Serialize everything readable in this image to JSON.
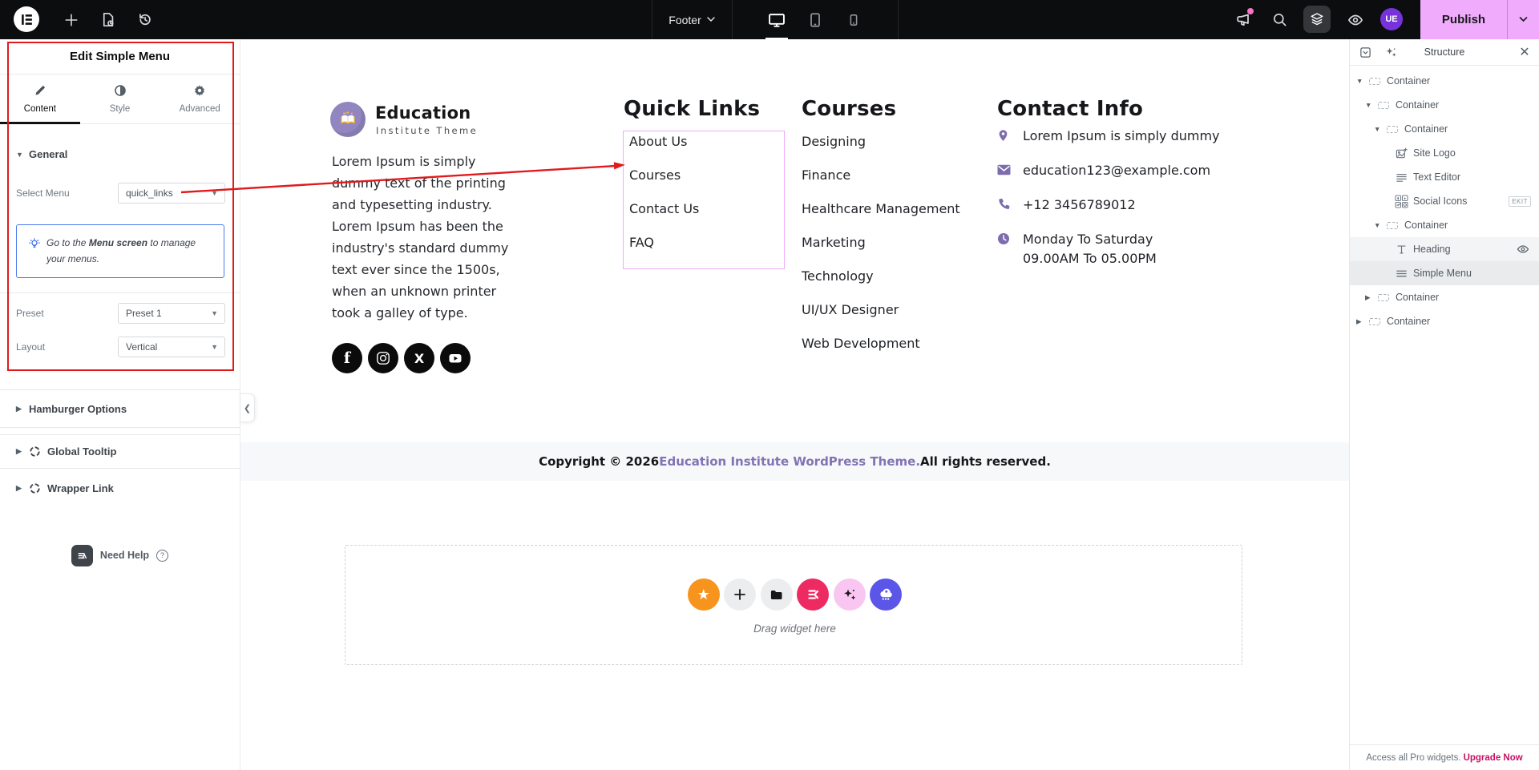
{
  "colors": {
    "topbar_bg": "#0C0D0E",
    "accent_pink": "#F0ABFC",
    "annotation_red": "#E11B1B",
    "avatar_purple": "#7733DB",
    "notice_blue": "#4A7BEF",
    "contact_purple": "#7D6CAE",
    "link_purple": "#8273B4",
    "upgrade_pink": "#C51162",
    "star_orange": "#F7941D",
    "elementskit_pink": "#EE2A62",
    "ai_pink": "#F9C6F1",
    "templately_indigo": "#5C56E8"
  },
  "topbar": {
    "page_name": "Footer",
    "publish_label": "Publish",
    "avatar_initials": "UE",
    "devices": [
      "desktop",
      "tablet",
      "mobile"
    ]
  },
  "panel": {
    "title": "Edit Simple Menu",
    "tabs": [
      {
        "label": "Content",
        "icon": "pencil",
        "active": true
      },
      {
        "label": "Style",
        "icon": "contrast",
        "active": false
      },
      {
        "label": "Advanced",
        "icon": "gear",
        "active": false
      }
    ],
    "general": {
      "header": "General",
      "select_menu_label": "Select Menu",
      "select_menu_value": "quick_links",
      "notice": {
        "prefix": "Go to the ",
        "bold": "Menu screen",
        "suffix": " to manage your menus."
      },
      "preset_label": "Preset",
      "preset_value": "Preset 1",
      "layout_label": "Layout",
      "layout_value": "Vertical"
    },
    "hamburger_label": "Hamburger Options",
    "global_tooltip_label": "Global Tooltip",
    "wrapper_link_label": "Wrapper Link",
    "need_help_label": "Need Help"
  },
  "canvas": {
    "logo": {
      "title": "Education",
      "subtitle": "Institute Theme"
    },
    "about_lines": [
      "Lorem Ipsum is simply",
      "dummy text of the printing",
      "and typesetting industry.",
      "Lorem Ipsum has been the",
      "industry's standard dummy",
      "text ever since the 1500s,",
      "when an unknown printer",
      "took a galley of type."
    ],
    "social": [
      "facebook",
      "instagram",
      "x",
      "youtube"
    ],
    "quick_links": {
      "title": "Quick Links",
      "items": [
        "About Us",
        "Courses",
        "Contact Us",
        "FAQ"
      ]
    },
    "courses": {
      "title": "Courses",
      "items": [
        "Designing",
        "Finance",
        "Healthcare Management",
        "Marketing",
        "Technology",
        "UI/UX Designer",
        "Web Development"
      ]
    },
    "contact": {
      "title": "Contact Info",
      "items": [
        {
          "icon": "location-pin",
          "lines": [
            "Lorem Ipsum is simply dummy"
          ]
        },
        {
          "icon": "envelope",
          "lines": [
            "education123@example.com"
          ]
        },
        {
          "icon": "phone",
          "lines": [
            "+12 3456789012"
          ]
        },
        {
          "icon": "clock",
          "lines": [
            "Monday To Saturday",
            "09.00AM To 05.00PM"
          ]
        }
      ]
    },
    "copyright": {
      "prefix": "Copyright © 2026 ",
      "link": "Education Institute WordPress Theme.",
      "suffix": " All rights reserved."
    },
    "drop_hint": "Drag widget here",
    "widget_buttons": [
      "favorites",
      "add-widget",
      "folder",
      "elementskit",
      "ai",
      "templately"
    ]
  },
  "structure": {
    "title": "Structure",
    "tree": [
      {
        "label": "Container",
        "depth": 0,
        "arrow": "down",
        "icon": "container"
      },
      {
        "label": "Container",
        "depth": 1,
        "arrow": "down",
        "icon": "container"
      },
      {
        "label": "Container",
        "depth": 2,
        "arrow": "down",
        "icon": "container"
      },
      {
        "label": "Site Logo",
        "depth": 3,
        "icon": "site-logo"
      },
      {
        "label": "Text Editor",
        "depth": 3,
        "icon": "text-editor"
      },
      {
        "label": "Social Icons",
        "depth": 3,
        "icon": "social-icons",
        "badge": "EKIT"
      },
      {
        "label": "Container",
        "depth": 2,
        "arrow": "down",
        "icon": "container"
      },
      {
        "label": "Heading",
        "depth": 3,
        "icon": "heading",
        "state": "hover",
        "eye": true
      },
      {
        "label": "Simple Menu",
        "depth": 3,
        "icon": "simple-menu",
        "state": "selected"
      },
      {
        "label": "Container",
        "depth": 1,
        "arrow": "right",
        "icon": "container"
      },
      {
        "label": "Container",
        "depth": 0,
        "arrow": "right",
        "icon": "container"
      }
    ],
    "footer": {
      "text": "Access all Pro widgets.",
      "link": "Upgrade Now"
    }
  }
}
